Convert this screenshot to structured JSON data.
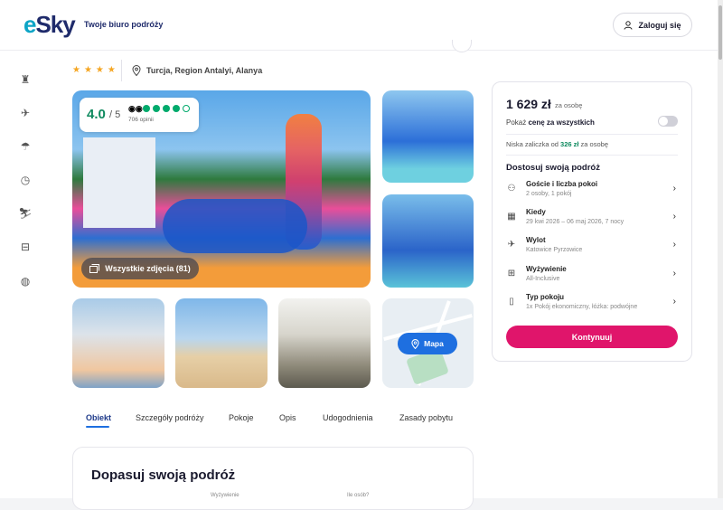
{
  "header": {
    "logo": "eSky",
    "tagline": "Twoje biuro podróży",
    "login_label": "Zaloguj się"
  },
  "sidebar": {
    "icons": [
      "hotel-icon",
      "flight-icon",
      "beach-icon",
      "clock-icon",
      "ski-icon",
      "bed-icon",
      "globe-icon"
    ]
  },
  "hotel": {
    "stars": "★★★★",
    "location": "Turcja, Region Antalyi, Alanya"
  },
  "rating": {
    "score": "4.0",
    "of": "/ 5",
    "opinions": "706 opinii",
    "dots_filled": 4,
    "dots_total": 5
  },
  "gallery": {
    "all_photos_label": "Wszystkie zdjęcia (81)",
    "map_label": "Mapa"
  },
  "tabs": [
    "Obiekt",
    "Szczegóły podróży",
    "Pokoje",
    "Opis",
    "Udogodnienia",
    "Zasady pobytu"
  ],
  "section": {
    "title": "Dopasuj swoją podróż",
    "field1": "Wyżywienie",
    "field2": "Ile osób?"
  },
  "booking": {
    "price": "1 629 zł",
    "price_sub": "za osobę",
    "show_all_prefix": "Pokaż ",
    "show_all_bold": "cenę za wszystkich",
    "deposit_prefix": "Niska zaliczka od ",
    "deposit_amount": "326 zł",
    "deposit_suffix": " za osobę",
    "customize_title": "Dostosuj swoją podróż",
    "options": [
      {
        "label": "Goście i liczba pokoi",
        "value": "2 osoby, 1 pokój",
        "icon": "guests-icon"
      },
      {
        "label": "Kiedy",
        "value": "29 kwi 2026 – 06 maj 2026, 7 nocy",
        "icon": "calendar-icon"
      },
      {
        "label": "Wylot",
        "value": "Katowice Pyrzowice",
        "icon": "plane-icon"
      },
      {
        "label": "Wyżywienie",
        "value": "All-Inclusive",
        "icon": "food-icon"
      },
      {
        "label": "Typ pokoju",
        "value": "1x Pokój ekonomiczny, łóżka: podwójne",
        "icon": "door-icon"
      }
    ],
    "continue_label": "Kontynuuj"
  }
}
